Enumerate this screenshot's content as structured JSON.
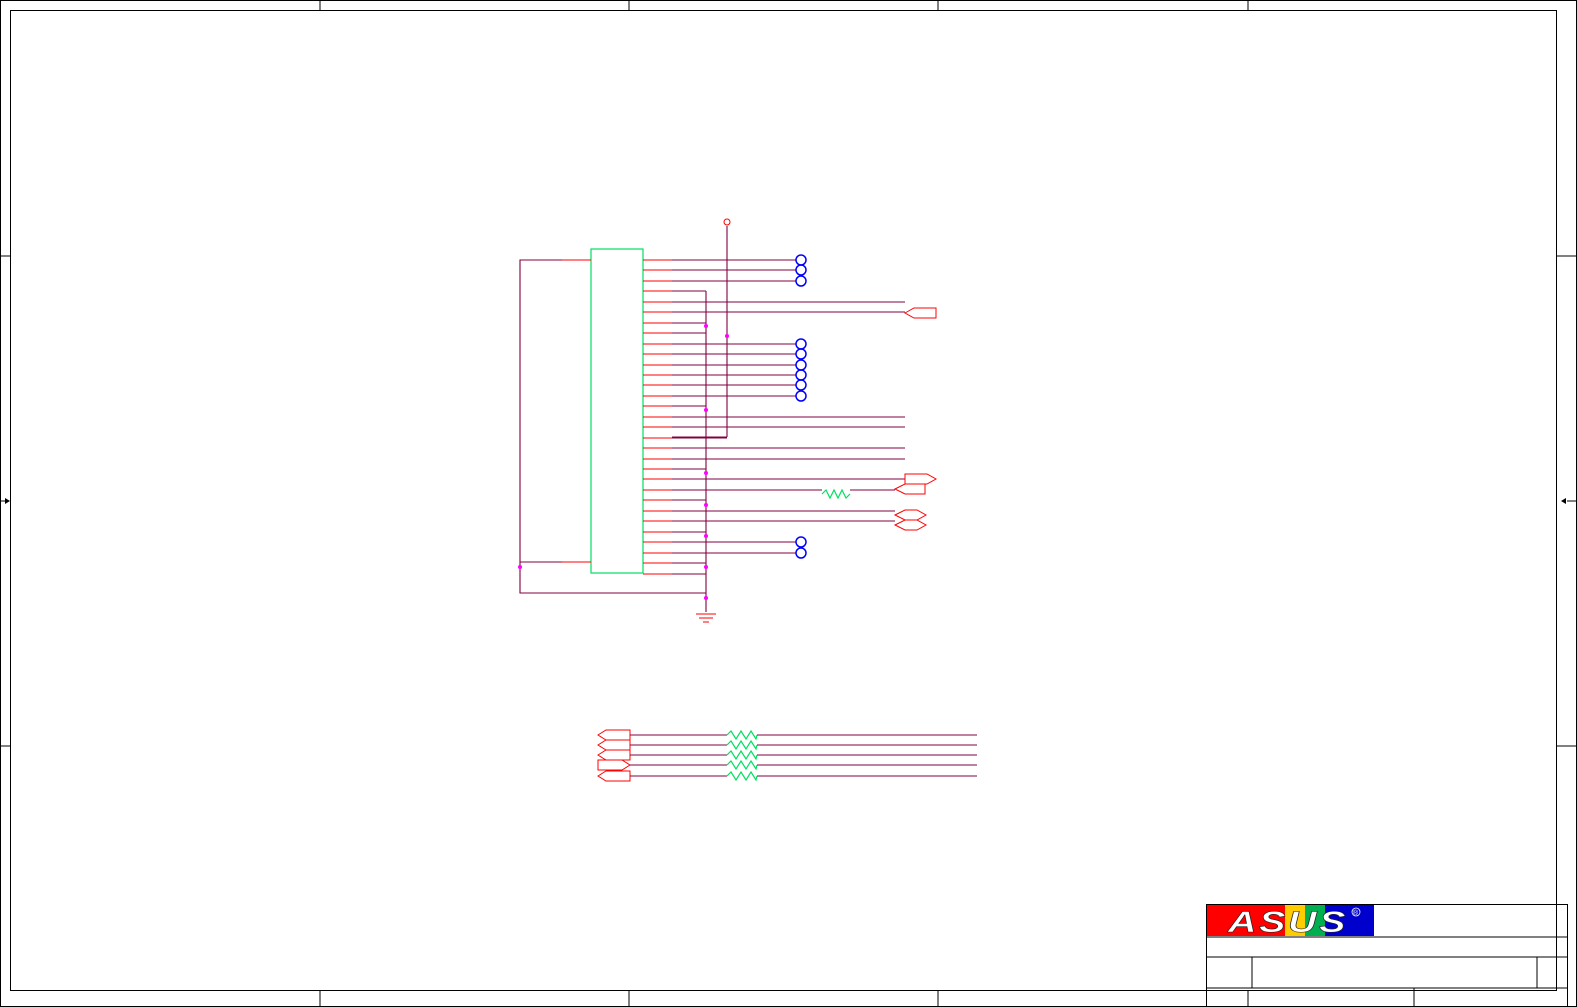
{
  "sheet": {
    "colors": {
      "border": "#000000",
      "wire": "#800040",
      "pin": "#ff0000",
      "component_body": "#00e060",
      "junction": "#ff00ff",
      "test_point": "#0000ff",
      "resistor": "#00e060",
      "logo_red": "#ff0000",
      "logo_blue": "#0000cc"
    }
  },
  "connector": {
    "pin_count_right": 31,
    "pin_count_left": 2
  },
  "logo": {
    "text": "ASUS",
    "registered_mark": "®"
  }
}
